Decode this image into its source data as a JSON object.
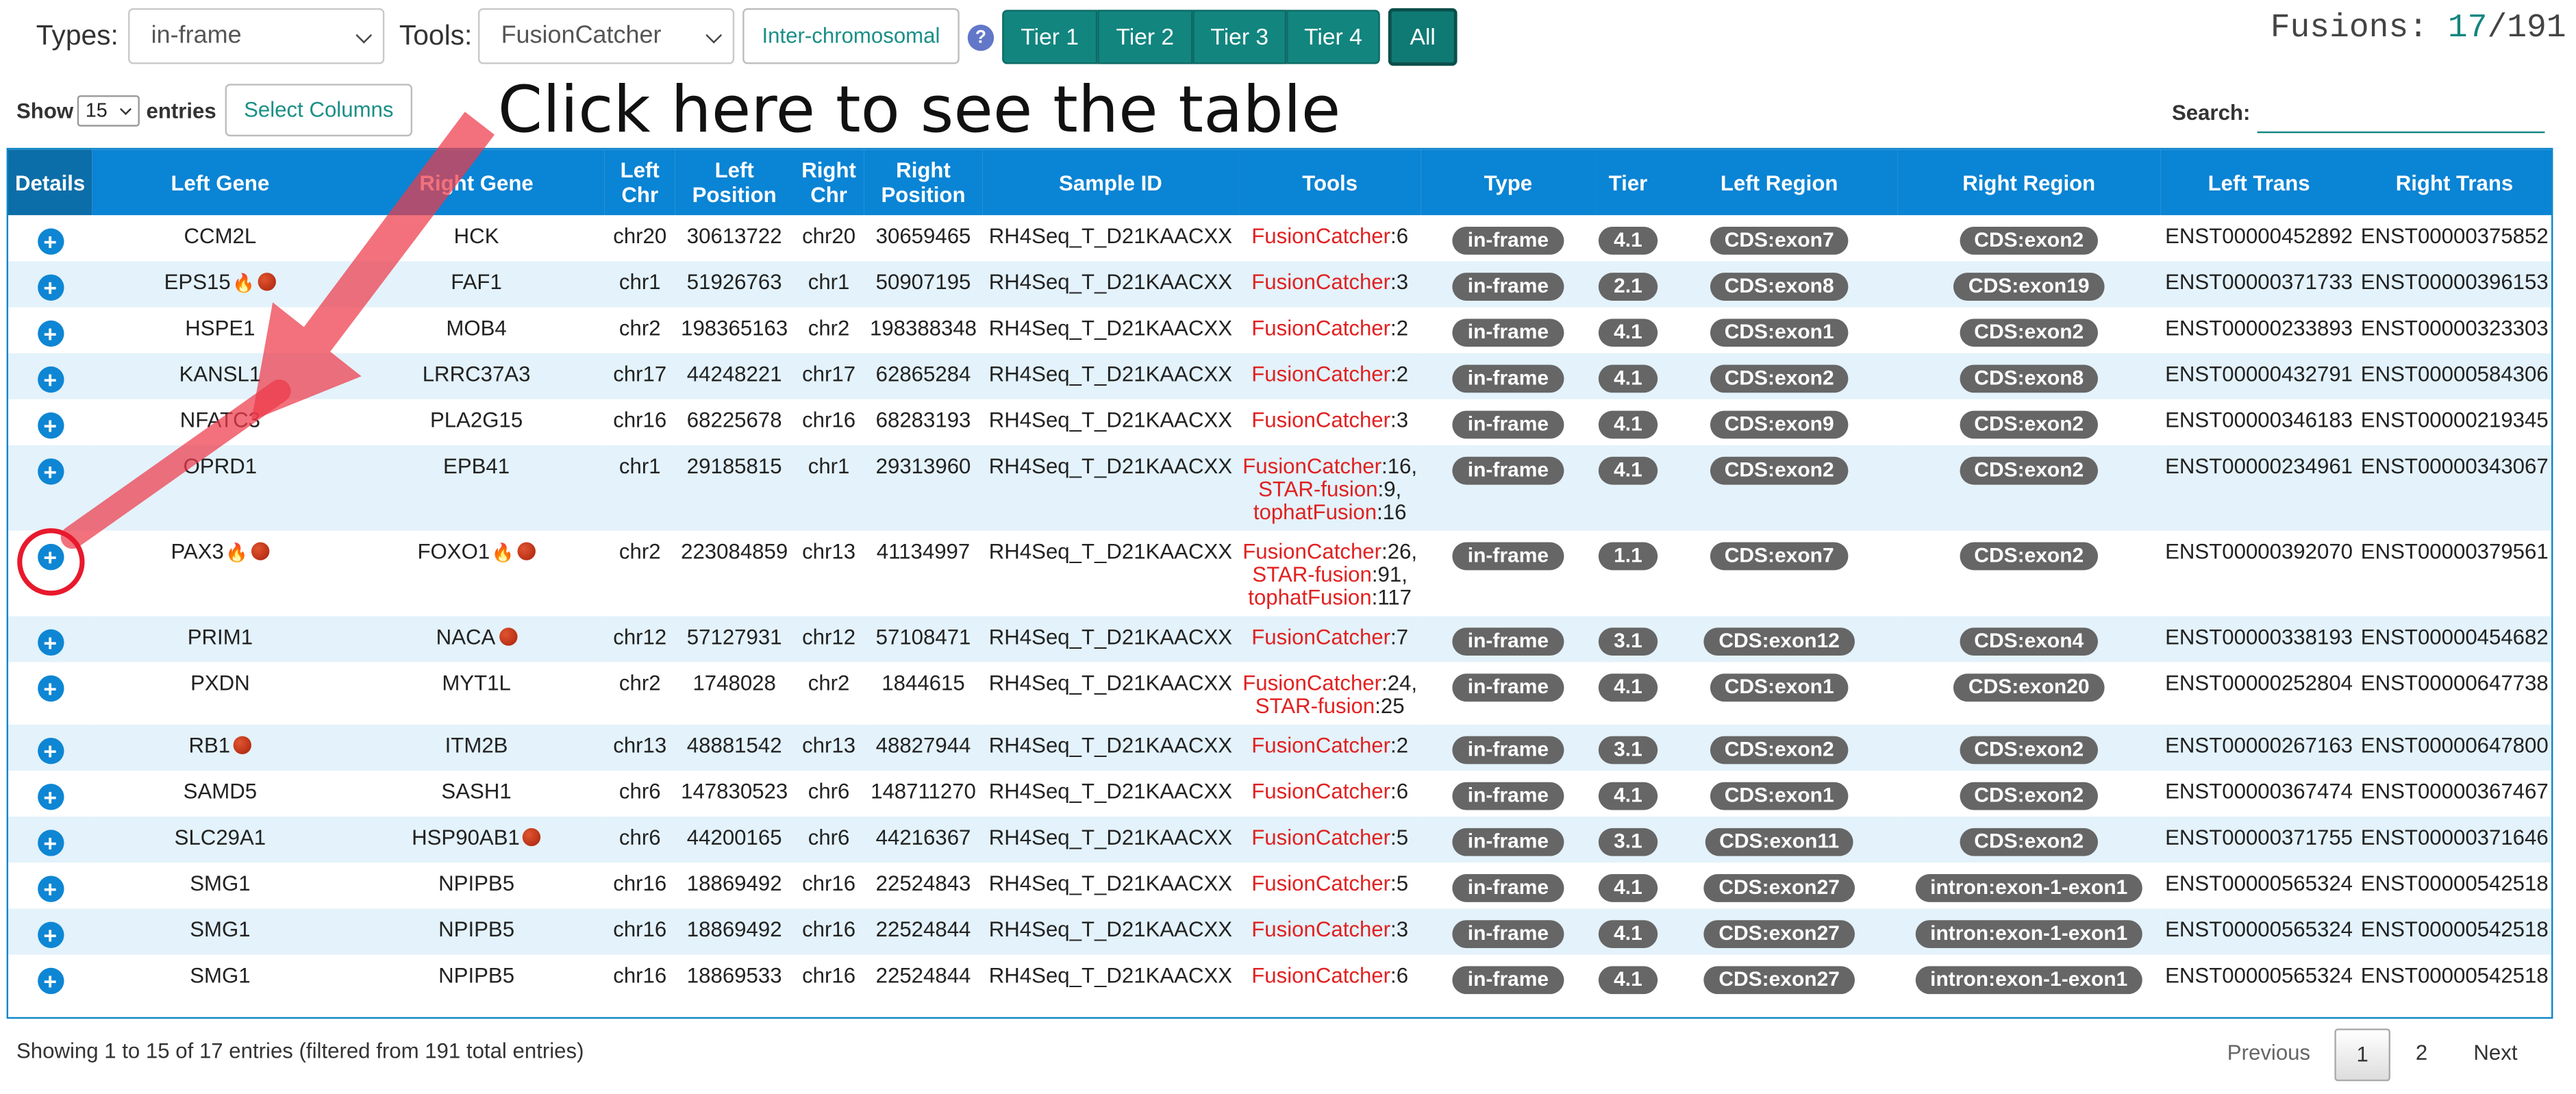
{
  "filters": {
    "types_label": "Types:",
    "types_value": "in-frame",
    "tools_label": "Tools:",
    "tools_value": "FusionCatcher",
    "inter_chromosomal": "Inter-chromosomal",
    "help": "?",
    "tiers": [
      "Tier 1",
      "Tier 2",
      "Tier 3",
      "Tier 4",
      "All"
    ]
  },
  "fusions": {
    "label": "Fusions: ",
    "shown": "17",
    "total": "/191"
  },
  "controls": {
    "show_label": "Show",
    "entries_value": "15",
    "entries_label": "entries",
    "select_columns": "Select Columns",
    "search_label": "Search:"
  },
  "annotation": {
    "text": "Click here to see the table"
  },
  "table": {
    "columns": [
      "Details",
      "Left Gene",
      "Right Gene",
      "Left Chr",
      "Left Position",
      "Right Chr",
      "Right Position",
      "Sample ID",
      "Tools",
      "Type",
      "Tier",
      "Left Region",
      "Right Region",
      "Left Trans",
      "Right Trans"
    ],
    "rows": [
      {
        "left_gene": "CCM2L",
        "left_marks": [],
        "right_gene": "HCK",
        "right_marks": [],
        "left_chr": "chr20",
        "left_pos": "30613722",
        "right_chr": "chr20",
        "right_pos": "30659465",
        "sample": "RH4Seq_T_D21KAACXX",
        "tools": [
          [
            "FusionCatcher",
            ":6"
          ]
        ],
        "type": "in-frame",
        "tier": "4.1",
        "left_region": "CDS:exon7",
        "right_region": "CDS:exon2",
        "left_trans": "ENST00000452892",
        "right_trans": "ENST00000375852"
      },
      {
        "left_gene": "EPS15",
        "left_marks": [
          "fire",
          "dot"
        ],
        "right_gene": "FAF1",
        "right_marks": [],
        "left_chr": "chr1",
        "left_pos": "51926763",
        "right_chr": "chr1",
        "right_pos": "50907195",
        "sample": "RH4Seq_T_D21KAACXX",
        "tools": [
          [
            "FusionCatcher",
            ":3"
          ]
        ],
        "type": "in-frame",
        "tier": "2.1",
        "left_region": "CDS:exon8",
        "right_region": "CDS:exon19",
        "left_trans": "ENST00000371733",
        "right_trans": "ENST00000396153"
      },
      {
        "left_gene": "HSPE1",
        "left_marks": [],
        "right_gene": "MOB4",
        "right_marks": [],
        "left_chr": "chr2",
        "left_pos": "198365163",
        "right_chr": "chr2",
        "right_pos": "198388348",
        "sample": "RH4Seq_T_D21KAACXX",
        "tools": [
          [
            "FusionCatcher",
            ":2"
          ]
        ],
        "type": "in-frame",
        "tier": "4.1",
        "left_region": "CDS:exon1",
        "right_region": "CDS:exon2",
        "left_trans": "ENST00000233893",
        "right_trans": "ENST00000323303"
      },
      {
        "left_gene": "KANSL1",
        "left_marks": [],
        "right_gene": "LRRC37A3",
        "right_marks": [],
        "left_chr": "chr17",
        "left_pos": "44248221",
        "right_chr": "chr17",
        "right_pos": "62865284",
        "sample": "RH4Seq_T_D21KAACXX",
        "tools": [
          [
            "FusionCatcher",
            ":2"
          ]
        ],
        "type": "in-frame",
        "tier": "4.1",
        "left_region": "CDS:exon2",
        "right_region": "CDS:exon8",
        "left_trans": "ENST00000432791",
        "right_trans": "ENST00000584306"
      },
      {
        "left_gene": "NFATC3",
        "left_marks": [],
        "right_gene": "PLA2G15",
        "right_marks": [],
        "left_chr": "chr16",
        "left_pos": "68225678",
        "right_chr": "chr16",
        "right_pos": "68283193",
        "sample": "RH4Seq_T_D21KAACXX",
        "tools": [
          [
            "FusionCatcher",
            ":3"
          ]
        ],
        "type": "in-frame",
        "tier": "4.1",
        "left_region": "CDS:exon9",
        "right_region": "CDS:exon2",
        "left_trans": "ENST00000346183",
        "right_trans": "ENST00000219345"
      },
      {
        "left_gene": "OPRD1",
        "left_marks": [],
        "right_gene": "EPB41",
        "right_marks": [],
        "left_chr": "chr1",
        "left_pos": "29185815",
        "right_chr": "chr1",
        "right_pos": "29313960",
        "sample": "RH4Seq_T_D21KAACXX",
        "tools": [
          [
            "FusionCatcher",
            ":16,"
          ],
          [
            "STAR-fusion",
            ":9,"
          ],
          [
            "tophatFusion",
            ":16"
          ]
        ],
        "type": "in-frame",
        "tier": "4.1",
        "left_region": "CDS:exon2",
        "right_region": "CDS:exon2",
        "left_trans": "ENST00000234961",
        "right_trans": "ENST00000343067"
      },
      {
        "left_gene": "PAX3",
        "left_marks": [
          "fire",
          "dot"
        ],
        "right_gene": "FOXO1",
        "right_marks": [
          "fire",
          "dot"
        ],
        "left_chr": "chr2",
        "left_pos": "223084859",
        "right_chr": "chr13",
        "right_pos": "41134997",
        "sample": "RH4Seq_T_D21KAACXX",
        "tools": [
          [
            "FusionCatcher",
            ":26,"
          ],
          [
            "STAR-fusion",
            ":91,"
          ],
          [
            "tophatFusion",
            ":117"
          ]
        ],
        "type": "in-frame",
        "tier": "1.1",
        "left_region": "CDS:exon7",
        "right_region": "CDS:exon2",
        "left_trans": "ENST00000392070",
        "right_trans": "ENST00000379561"
      },
      {
        "left_gene": "PRIM1",
        "left_marks": [],
        "right_gene": "NACA",
        "right_marks": [
          "dot"
        ],
        "left_chr": "chr12",
        "left_pos": "57127931",
        "right_chr": "chr12",
        "right_pos": "57108471",
        "sample": "RH4Seq_T_D21KAACXX",
        "tools": [
          [
            "FusionCatcher",
            ":7"
          ]
        ],
        "type": "in-frame",
        "tier": "3.1",
        "left_region": "CDS:exon12",
        "right_region": "CDS:exon4",
        "left_trans": "ENST00000338193",
        "right_trans": "ENST00000454682"
      },
      {
        "left_gene": "PXDN",
        "left_marks": [],
        "right_gene": "MYT1L",
        "right_marks": [],
        "left_chr": "chr2",
        "left_pos": "1748028",
        "right_chr": "chr2",
        "right_pos": "1844615",
        "sample": "RH4Seq_T_D21KAACXX",
        "tools": [
          [
            "FusionCatcher",
            ":24,"
          ],
          [
            "STAR-fusion",
            ":25"
          ]
        ],
        "type": "in-frame",
        "tier": "4.1",
        "left_region": "CDS:exon1",
        "right_region": "CDS:exon20",
        "left_trans": "ENST00000252804",
        "right_trans": "ENST00000647738"
      },
      {
        "left_gene": "RB1",
        "left_marks": [
          "dot"
        ],
        "right_gene": "ITM2B",
        "right_marks": [],
        "left_chr": "chr13",
        "left_pos": "48881542",
        "right_chr": "chr13",
        "right_pos": "48827944",
        "sample": "RH4Seq_T_D21KAACXX",
        "tools": [
          [
            "FusionCatcher",
            ":2"
          ]
        ],
        "type": "in-frame",
        "tier": "3.1",
        "left_region": "CDS:exon2",
        "right_region": "CDS:exon2",
        "left_trans": "ENST00000267163",
        "right_trans": "ENST00000647800"
      },
      {
        "left_gene": "SAMD5",
        "left_marks": [],
        "right_gene": "SASH1",
        "right_marks": [],
        "left_chr": "chr6",
        "left_pos": "147830523",
        "right_chr": "chr6",
        "right_pos": "148711270",
        "sample": "RH4Seq_T_D21KAACXX",
        "tools": [
          [
            "FusionCatcher",
            ":6"
          ]
        ],
        "type": "in-frame",
        "tier": "4.1",
        "left_region": "CDS:exon1",
        "right_region": "CDS:exon2",
        "left_trans": "ENST00000367474",
        "right_trans": "ENST00000367467"
      },
      {
        "left_gene": "SLC29A1",
        "left_marks": [],
        "right_gene": "HSP90AB1",
        "right_marks": [
          "dot"
        ],
        "left_chr": "chr6",
        "left_pos": "44200165",
        "right_chr": "chr6",
        "right_pos": "44216367",
        "sample": "RH4Seq_T_D21KAACXX",
        "tools": [
          [
            "FusionCatcher",
            ":5"
          ]
        ],
        "type": "in-frame",
        "tier": "3.1",
        "left_region": "CDS:exon11",
        "right_region": "CDS:exon2",
        "left_trans": "ENST00000371755",
        "right_trans": "ENST00000371646"
      },
      {
        "left_gene": "SMG1",
        "left_marks": [],
        "right_gene": "NPIPB5",
        "right_marks": [],
        "left_chr": "chr16",
        "left_pos": "18869492",
        "right_chr": "chr16",
        "right_pos": "22524843",
        "sample": "RH4Seq_T_D21KAACXX",
        "tools": [
          [
            "FusionCatcher",
            ":5"
          ]
        ],
        "type": "in-frame",
        "tier": "4.1",
        "left_region": "CDS:exon27",
        "right_region": "intron:exon-1-exon1",
        "left_trans": "ENST00000565324",
        "right_trans": "ENST00000542518"
      },
      {
        "left_gene": "SMG1",
        "left_marks": [],
        "right_gene": "NPIPB5",
        "right_marks": [],
        "left_chr": "chr16",
        "left_pos": "18869492",
        "right_chr": "chr16",
        "right_pos": "22524844",
        "sample": "RH4Seq_T_D21KAACXX",
        "tools": [
          [
            "FusionCatcher",
            ":3"
          ]
        ],
        "type": "in-frame",
        "tier": "4.1",
        "left_region": "CDS:exon27",
        "right_region": "intron:exon-1-exon1",
        "left_trans": "ENST00000565324",
        "right_trans": "ENST00000542518"
      },
      {
        "left_gene": "SMG1",
        "left_marks": [],
        "right_gene": "NPIPB5",
        "right_marks": [],
        "left_chr": "chr16",
        "left_pos": "18869533",
        "right_chr": "chr16",
        "right_pos": "22524844",
        "sample": "RH4Seq_T_D21KAACXX",
        "tools": [
          [
            "FusionCatcher",
            ":6"
          ]
        ],
        "type": "in-frame",
        "tier": "4.1",
        "left_region": "CDS:exon27",
        "right_region": "intron:exon-1-exon1",
        "left_trans": "ENST00000565324",
        "right_trans": "ENST00000542518"
      }
    ]
  },
  "footer": {
    "info": "Showing 1 to 15 of 17 entries (filtered from 191 total entries)",
    "previous": "Previous",
    "pages": [
      "1",
      "2"
    ],
    "next": "Next"
  },
  "colors": {
    "accent": "#12857f",
    "header": "#0a84d4",
    "tool_text": "#e12020",
    "pill": "#666666",
    "annotation": "#e8192c"
  },
  "icons": {
    "details": "plus-circle-icon",
    "help": "question-circle-icon",
    "fire": "fire-icon",
    "dot": "red-dot-icon",
    "arrow": "arrow-icon"
  }
}
